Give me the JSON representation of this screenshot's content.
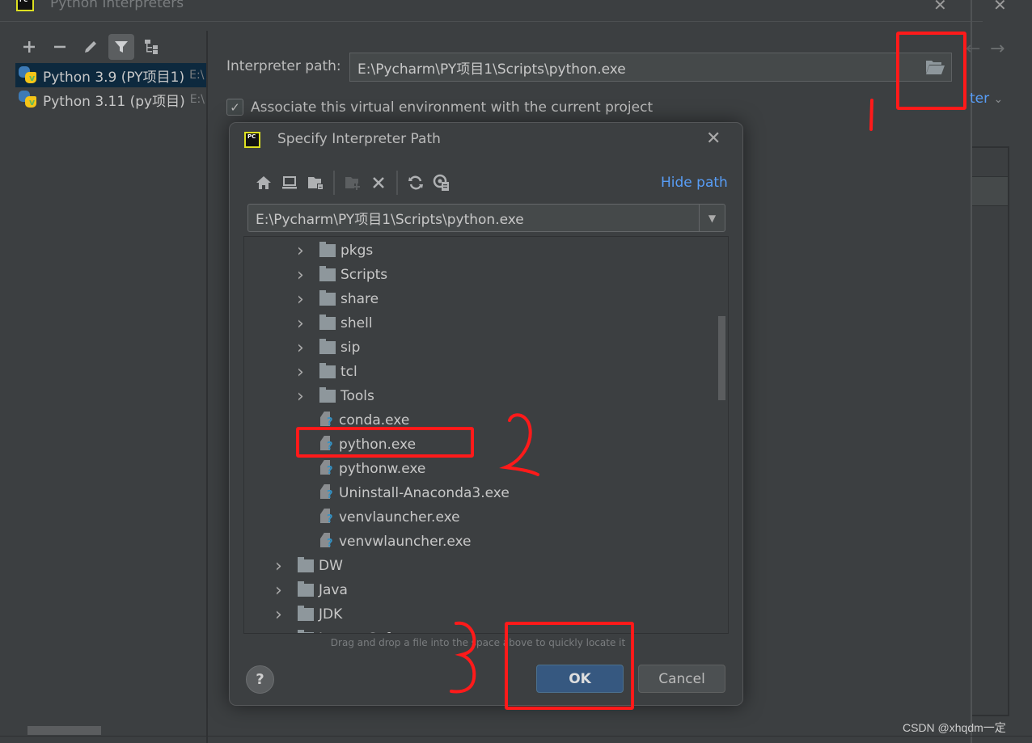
{
  "window": {
    "title": "Python Interpreters",
    "logo_text": "PC"
  },
  "left_toolbar": {
    "icons": [
      "plus-icon",
      "minus-icon",
      "pencil-icon",
      "filter-icon",
      "tree-icon"
    ]
  },
  "interpreters": [
    {
      "name": "Python 3.9 (PY项目1)",
      "path": "E:\\",
      "selected": true
    },
    {
      "name": "Python 3.11 (py项目)",
      "path": "E:\\",
      "selected": false
    }
  ],
  "details": {
    "interpreter_path_label": "Interpreter path:",
    "interpreter_path_value": "E:\\Pycharm\\PY项目1\\Scripts\\python.exe",
    "associate_label": "Associate this virtual environment with the current project",
    "associate_checked": true,
    "right_link_fragment": "ter",
    "right_chevron": "⌄"
  },
  "dialog": {
    "title": "Specify Interpreter Path",
    "logo_text": "PC",
    "hide_path_label": "Hide path",
    "path_value": "E:\\Pycharm\\PY项目1\\Scripts\\python.exe",
    "tree": [
      {
        "type": "folder",
        "label": "pkgs",
        "level": 2
      },
      {
        "type": "folder",
        "label": "Scripts",
        "level": 2
      },
      {
        "type": "folder",
        "label": "share",
        "level": 2
      },
      {
        "type": "folder",
        "label": "shell",
        "level": 2
      },
      {
        "type": "folder",
        "label": "sip",
        "level": 2
      },
      {
        "type": "folder",
        "label": "tcl",
        "level": 2
      },
      {
        "type": "folder",
        "label": "Tools",
        "level": 2
      },
      {
        "type": "file",
        "label": " conda.exe",
        "level": 2
      },
      {
        "type": "file",
        "label": "python.exe",
        "level": 2
      },
      {
        "type": "file",
        "label": "pythonw.exe",
        "level": 2
      },
      {
        "type": "file",
        "label": "Uninstall-Anaconda3.exe",
        "level": 2
      },
      {
        "type": "file",
        "label": "venvlauncher.exe",
        "level": 2
      },
      {
        "type": "file",
        "label": "venvwlauncher.exe",
        "level": 2
      },
      {
        "type": "folder",
        "label": "DW",
        "level": 1
      },
      {
        "type": "folder",
        "label": "Java",
        "level": 1
      },
      {
        "type": "folder",
        "label": "JDK",
        "level": 1
      },
      {
        "type": "folder",
        "label": "LenovoSoftstore",
        "level": 1
      }
    ],
    "drag_hint": "Drag and drop a file into the space above to quickly locate it",
    "help_label": "?",
    "ok_label": "OK",
    "cancel_label": "Cancel"
  },
  "annotations": {
    "step1": "1",
    "step2": "2",
    "step3": "3",
    "color": "#ff1a1a"
  },
  "watermark": "CSDN @xhqdm一定"
}
